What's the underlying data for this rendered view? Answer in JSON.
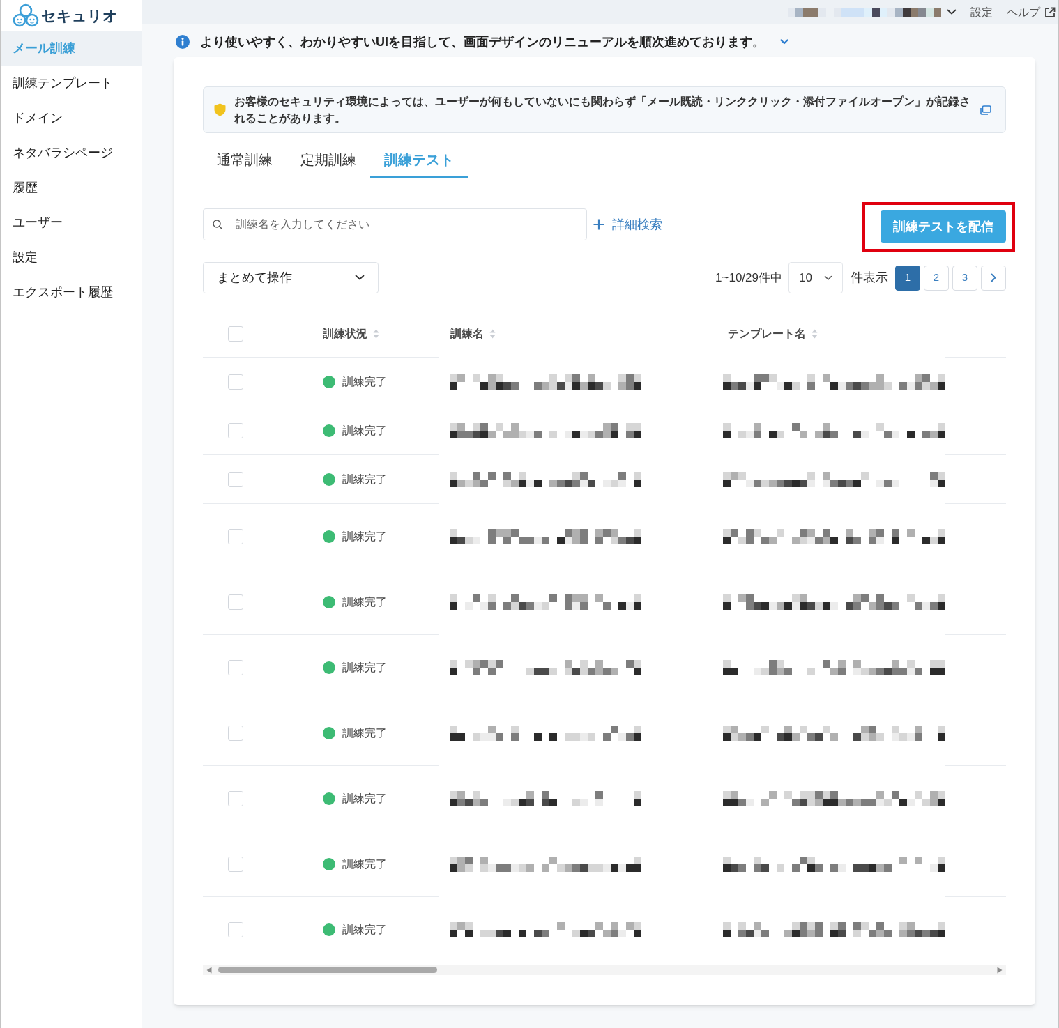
{
  "logo": {
    "text": "セキュリオ"
  },
  "sidebar": {
    "items": [
      {
        "label": "メール訓練",
        "selected": true
      },
      {
        "label": "訓練テンプレート",
        "selected": false
      },
      {
        "label": "ドメイン",
        "selected": false
      },
      {
        "label": "ネタバラシページ",
        "selected": false
      },
      {
        "label": "履歴",
        "selected": false
      },
      {
        "label": "ユーザー",
        "selected": false
      },
      {
        "label": "設定",
        "selected": false
      },
      {
        "label": "エクスポート履歴",
        "selected": false
      }
    ]
  },
  "top_bar": {
    "links": [
      {
        "label": "設定",
        "kind": "plain"
      },
      {
        "label": "ヘルプ",
        "kind": "external"
      }
    ]
  },
  "notice": {
    "text": "より使いやすく、わかりやすいUIを目指して、画面デザインのリニューアルを順次進めております。"
  },
  "alert": {
    "text": "お客様のセキュリティ環境によっては、ユーザーが何もしていないにも関わらず「メール既読・リンククリック・添付ファイルオープン」が記録されることがあります。"
  },
  "tabs": [
    {
      "label": "通常訓練",
      "selected": false
    },
    {
      "label": "定期訓練",
      "selected": false
    },
    {
      "label": "訓練テスト",
      "selected": true
    }
  ],
  "search": {
    "placeholder": "訓練名を入力してください"
  },
  "advanced_search": {
    "label": "詳細検索"
  },
  "deliver_button": {
    "label": "訓練テストを配信",
    "highlighted": true
  },
  "bulk_action": {
    "label": "まとめて操作"
  },
  "pagination": {
    "summary": "1~10/29件中",
    "page_size": "10",
    "page_size_label": "件表示",
    "pages": [
      {
        "label": "1",
        "selected": true
      },
      {
        "label": "2",
        "selected": false
      },
      {
        "label": "3",
        "selected": false
      }
    ]
  },
  "table": {
    "select_all_checked": false,
    "columns": [
      {
        "label": "訓練状況"
      },
      {
        "label": "訓練名"
      },
      {
        "label": "テンプレート名"
      }
    ],
    "rows": [
      {
        "checked": false,
        "status": "訓練完了",
        "color": "#3dbb74"
      },
      {
        "checked": false,
        "status": "訓練完了",
        "color": "#3dbb74"
      },
      {
        "checked": false,
        "status": "訓練完了",
        "color": "#3dbb74"
      },
      {
        "checked": false,
        "status": "訓練完了",
        "color": "#3dbb74"
      },
      {
        "checked": false,
        "status": "訓練完了",
        "color": "#3dbb74"
      },
      {
        "checked": false,
        "status": "訓練完了",
        "color": "#3dbb74"
      },
      {
        "checked": false,
        "status": "訓練完了",
        "color": "#3dbb74"
      },
      {
        "checked": false,
        "status": "訓練完了",
        "color": "#3dbb74"
      },
      {
        "checked": false,
        "status": "訓練完了",
        "color": "#3dbb74"
      },
      {
        "checked": false,
        "status": "訓練完了",
        "color": "#3dbb74"
      }
    ]
  }
}
